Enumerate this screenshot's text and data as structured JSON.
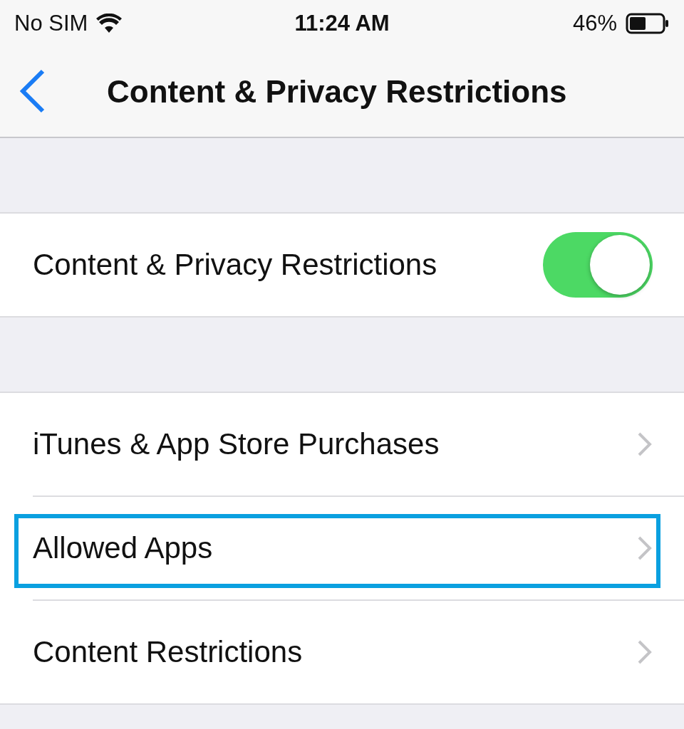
{
  "status_bar": {
    "carrier": "No SIM",
    "time": "11:24 AM",
    "battery": "46%"
  },
  "nav_bar": {
    "title": "Content & Privacy Restrictions"
  },
  "sections": [
    {
      "rows": [
        {
          "kind": "toggle",
          "label": "Content & Privacy Restrictions",
          "on": true
        }
      ]
    },
    {
      "rows": [
        {
          "kind": "link",
          "label": "iTunes & App Store Purchases",
          "highlighted": false
        },
        {
          "kind": "link",
          "label": "Allowed Apps",
          "highlighted": true
        },
        {
          "kind": "link",
          "label": "Content Restrictions",
          "highlighted": false
        }
      ]
    }
  ]
}
